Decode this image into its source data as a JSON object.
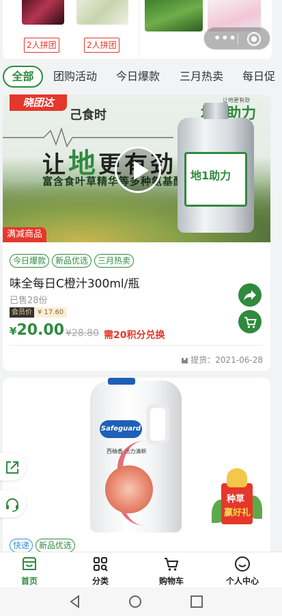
{
  "top_strip": {
    "group_tags": [
      "2人拼团",
      "2人拼团"
    ],
    "capsule": {
      "more_glyph": "•••",
      "close_icon": "target-icon"
    }
  },
  "tabs": [
    {
      "label": "全部",
      "active": true
    },
    {
      "label": "团购活动",
      "active": false
    },
    {
      "label": "今日爆款",
      "active": false
    },
    {
      "label": "三月热卖",
      "active": false
    },
    {
      "label": "每日促",
      "active": false
    }
  ],
  "products": [
    {
      "banner": {
        "logo_tag": "晓团达",
        "brand_text": "己食时",
        "slogan_pre": "让",
        "slogan_hl": "地",
        "slogan_post": "更有劲",
        "sub": "富含食叶草精华等多种氨基酸",
        "box_title": "地1助力",
        "box_small": "让地更有劲",
        "bottle_label": "地1助力"
      },
      "promo_badge": "满减商品",
      "tags": [
        "今日爆款",
        "新品优选",
        "三月热卖"
      ],
      "name": "味全每日C橙汁300ml/瓶",
      "sold": "已售28份",
      "member_label": "会员价",
      "member_price": "¥ 17.60",
      "price_currency": "¥",
      "price": "20.00",
      "orig_price": "¥28.80",
      "points": "需20积分兑换",
      "pickup": "提货：2021-06-28"
    },
    {
      "banner": {
        "brand": "Safeguard",
        "text": "西柚香·活力清新"
      },
      "tags": [
        {
          "label": "快递",
          "style": "blue"
        },
        {
          "label": "新品优选",
          "style": "green"
        }
      ]
    }
  ],
  "gift_float": {
    "line1": "种草",
    "line2": "赢好礼"
  },
  "tabbar": [
    {
      "label": "首页",
      "icon": "home-icon",
      "active": true
    },
    {
      "label": "分类",
      "icon": "grid-search-icon",
      "active": false
    },
    {
      "label": "购物车",
      "icon": "cart-icon",
      "active": false
    },
    {
      "label": "个人中心",
      "icon": "smile-icon",
      "active": false
    }
  ],
  "colors": {
    "brand_green": "#2f8a3e",
    "accent_red": "#e5372b",
    "blue_tag": "#3a8fd0"
  }
}
